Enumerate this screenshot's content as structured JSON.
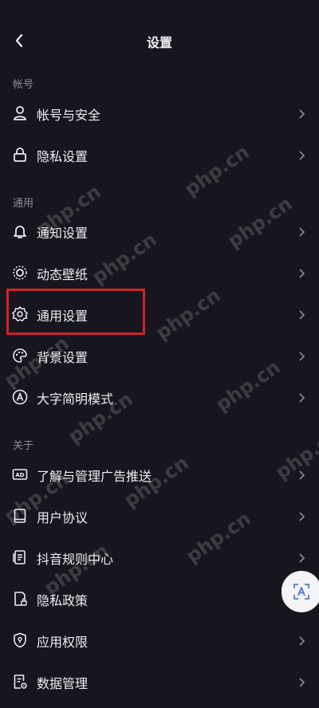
{
  "header": {
    "title": "设置",
    "back_icon": "chevron-left-icon"
  },
  "sections": {
    "account": "帐号",
    "general": "通用",
    "about": "关于"
  },
  "items": {
    "account_security": {
      "label": "帐号与安全",
      "icon": "person-icon"
    },
    "privacy_settings": {
      "label": "隐私设置",
      "icon": "lock-icon"
    },
    "notification_settings": {
      "label": "通知设置",
      "icon": "bell-icon"
    },
    "dynamic_wallpaper": {
      "label": "动态壁纸",
      "icon": "wallpaper-icon"
    },
    "general_settings": {
      "label": "通用设置",
      "icon": "gear-icon"
    },
    "background_settings": {
      "label": "背景设置",
      "icon": "palette-icon"
    },
    "large_text_mode": {
      "label": "大字简明模式",
      "icon": "text-a-icon"
    },
    "ad_management": {
      "label": "了解与管理广告推送",
      "icon": "ad-icon"
    },
    "user_agreement": {
      "label": "用户协议",
      "icon": "book-icon"
    },
    "community_rules": {
      "label": "抖音规则中心",
      "icon": "rules-doc-icon"
    },
    "privacy_policy": {
      "label": "隐私政策",
      "icon": "doc-lock-icon"
    },
    "app_permissions": {
      "label": "应用权限",
      "icon": "shield-icon"
    },
    "data_management": {
      "label": "数据管理",
      "icon": "data-settings-icon"
    }
  },
  "watermark": "php.cn",
  "colors": {
    "background": "#17161e",
    "highlight": "#d3202a",
    "text": "#eeecf2",
    "section_text": "#8e8b96"
  }
}
